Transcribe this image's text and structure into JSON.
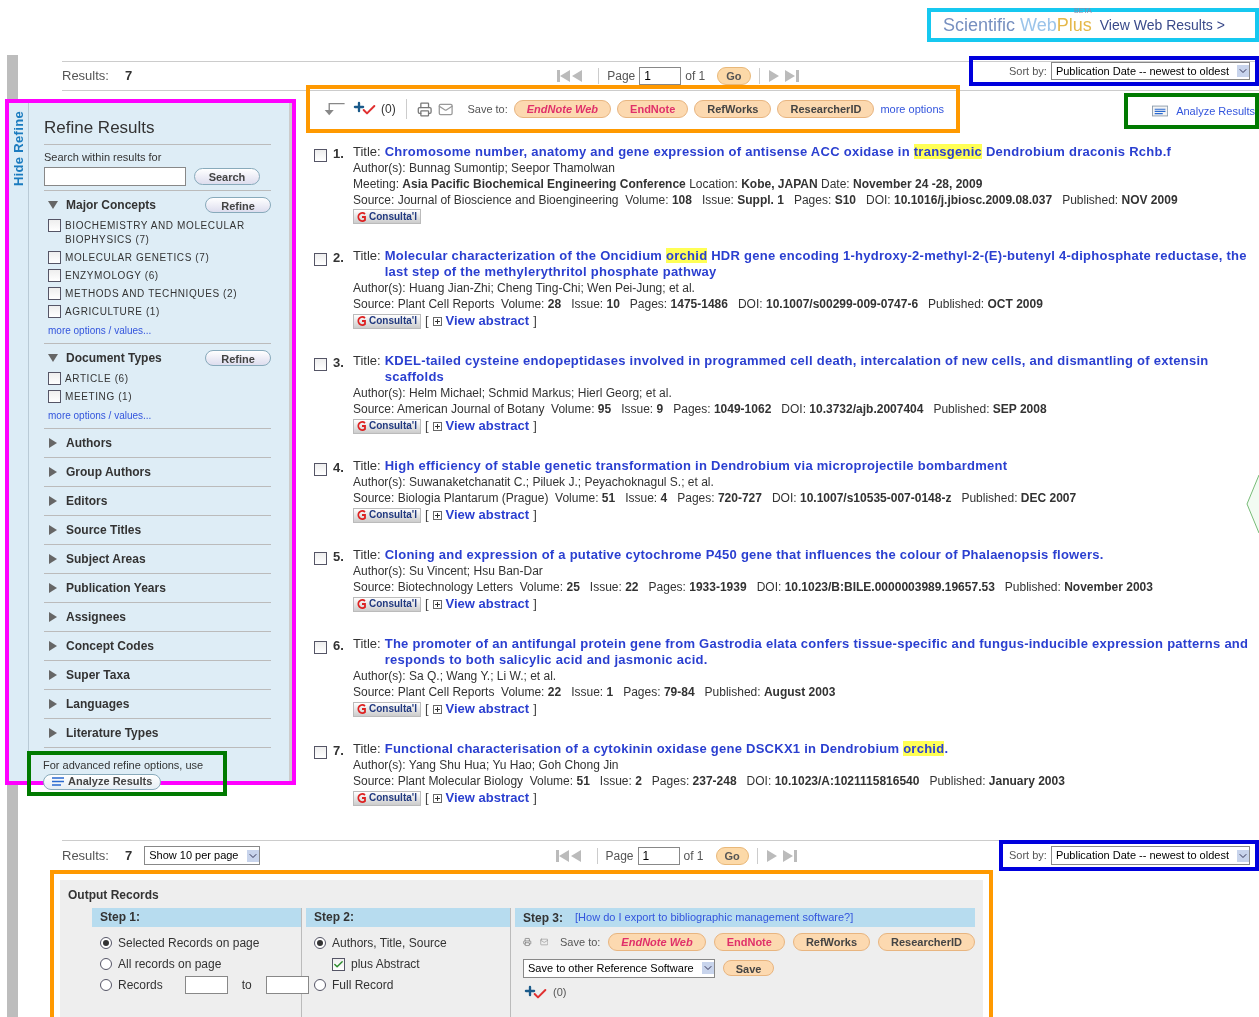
{
  "header": {
    "logo": {
      "word1": "Scientific ",
      "word2": "Web",
      "word3": "Plus",
      "badge": "BETA"
    },
    "view_web_link": "View Web Results >"
  },
  "top_bar": {
    "results_label": "Results:",
    "results_count": "7",
    "pager": {
      "page_label": "Page",
      "page_value": "1",
      "of_label": "of 1",
      "go": "Go"
    },
    "sort": {
      "label": "Sort by:",
      "value": "Publication Date -- newest to oldest"
    }
  },
  "toolbar": {
    "marked_count": "(0)",
    "save_to_label": "Save to:",
    "save_buttons": [
      {
        "label": "EndNote Web",
        "kind": "endnoteweb"
      },
      {
        "label": "EndNote",
        "kind": "endnote"
      },
      {
        "label": "RefWorks",
        "kind": "plain"
      },
      {
        "label": "ResearcherID",
        "kind": "plain"
      }
    ],
    "more_options": "more options",
    "analyze": "Analyze Results"
  },
  "sidebar": {
    "tab": "Hide Refine",
    "title": "Refine Results",
    "search_label": "Search within results for",
    "search_button": "Search",
    "sections": [
      {
        "label": "Major Concepts",
        "expanded": true,
        "refine_button": "Refine",
        "options": [
          {
            "label": "BIOCHEMISTRY AND MOLECULAR BIOPHYSICS (7)",
            "checked": false
          },
          {
            "label": "MOLECULAR GENETICS (7)",
            "checked": false
          },
          {
            "label": "ENZYMOLOGY (6)",
            "checked": false
          },
          {
            "label": "METHODS AND TECHNIQUES (2)",
            "checked": false
          },
          {
            "label": "AGRICULTURE (1)",
            "checked": false
          }
        ],
        "more": "more options / values..."
      },
      {
        "label": "Document Types",
        "expanded": true,
        "refine_button": "Refine",
        "options": [
          {
            "label": "ARTICLE (6)",
            "checked": false
          },
          {
            "label": "MEETING (1)",
            "checked": false
          }
        ],
        "more": "more options / values..."
      },
      {
        "label": "Authors",
        "expanded": false
      },
      {
        "label": "Group Authors",
        "expanded": false
      },
      {
        "label": "Editors",
        "expanded": false
      },
      {
        "label": "Source Titles",
        "expanded": false
      },
      {
        "label": "Subject Areas",
        "expanded": false
      },
      {
        "label": "Publication Years",
        "expanded": false
      },
      {
        "label": "Assignees",
        "expanded": false
      },
      {
        "label": "Concept Codes",
        "expanded": false
      },
      {
        "label": "Super Taxa",
        "expanded": false
      },
      {
        "label": "Languages",
        "expanded": false
      },
      {
        "label": "Literature Types",
        "expanded": false
      }
    ],
    "footer_text": "For advanced refine options, use",
    "footer_button": "Analyze Results"
  },
  "records": [
    {
      "number": "1.",
      "checked": false,
      "title_label": "Title:",
      "title": [
        {
          "text": "Chromosome number, anatomy and gene expression of antisense ACC oxidase in ",
          "highlight": false
        },
        {
          "text": "transgenic",
          "highlight": true
        },
        {
          "text": " Dendrobium draconis Rchb.f",
          "highlight": false
        }
      ],
      "lines": [
        "Author(s): Bunnag Sumontip; Seepor Thamolwan",
        "Meeting: **Asia Pacific Biochemical Engineering Conference** Location: **Kobe, JAPAN** Date: **November 24 -28, 2009**",
        "Source: Journal of Bioscience and Bioengineering  Volume: **108**   Issue: **Suppl. 1**   Pages: **S10**   DOI: **10.1016/j.jbiosc.2009.08.037**   Published: **NOV 2009**"
      ],
      "consult": "Consulta'l"
    },
    {
      "number": "2.",
      "checked": false,
      "title_label": "Title:",
      "title": [
        {
          "text": "Molecular characterization of the Oncidium ",
          "highlight": false
        },
        {
          "text": "orchid",
          "highlight": true
        },
        {
          "text": " HDR gene encoding 1-hydroxy-2-methyl-2-(E)-butenyl 4-diphosphate reductase, the last step of the methylerythritol phosphate pathway",
          "highlight": false
        }
      ],
      "lines": [
        "Author(s): Huang Jian-Zhi; Cheng Ting-Chi; Wen Pei-Jung; et al.",
        "Source: Plant Cell Reports  Volume: **28**   Issue: **10**   Pages: **1475-1486**   DOI: **10.1007/s00299-009-0747-6**   Published: **OCT 2009**"
      ],
      "consult": "Consulta'l",
      "abstract_open": "[",
      "abstract_link": "View abstract",
      "abstract_close": "]"
    },
    {
      "number": "3.",
      "checked": false,
      "title_label": "Title:",
      "title": [
        {
          "text": "KDEL-tailed cysteine endopeptidases involved in programmed cell death, intercalation of new cells, and dismantling of extensin scaffolds",
          "highlight": false
        }
      ],
      "lines": [
        "Author(s): Helm Michael; Schmid Markus; Hierl Georg; et al.",
        "Source: American Journal of Botany  Volume: **95**   Issue: **9**   Pages: **1049-1062**   DOI: **10.3732/ajb.2007404**   Published: **SEP 2008**"
      ],
      "consult": "Consulta'l",
      "abstract_open": "[",
      "abstract_link": "View abstract",
      "abstract_close": "]"
    },
    {
      "number": "4.",
      "checked": false,
      "title_label": "Title:",
      "title": [
        {
          "text": "High efficiency of stable genetic transformation in Dendrobium via microprojectile bombardment",
          "highlight": false
        }
      ],
      "lines": [
        "Author(s): Suwanaketchanatit C.; Piluek J.; Peyachoknagul S.; et al.",
        "Source: Biologia Plantarum (Prague)  Volume: **51**   Issue: **4**   Pages: **720-727**   DOI: **10.1007/s10535-007-0148-z**   Published: **DEC 2007**"
      ],
      "consult": "Consulta'l",
      "abstract_open": "[",
      "abstract_link": "View abstract",
      "abstract_close": "]"
    },
    {
      "number": "5.",
      "checked": false,
      "title_label": "Title:",
      "title": [
        {
          "text": "Cloning and expression of a putative cytochrome P450 gene that influences the colour of Phalaenopsis flowers.",
          "highlight": false
        }
      ],
      "lines": [
        "Author(s): Su Vincent; Hsu Ban-Dar",
        "Source: Biotechnology Letters  Volume: **25**   Issue: **22**   Pages: **1933-1939**   DOI: **10.1023/B:BILE.0000003989.19657.53**   Published: **November 2003**"
      ],
      "consult": "Consulta'l",
      "abstract_open": "[",
      "abstract_link": "View abstract",
      "abstract_close": "]"
    },
    {
      "number": "6.",
      "checked": false,
      "title_label": "Title:",
      "title": [
        {
          "text": "The promoter of an antifungal protein gene from Gastrodia elata confers tissue-specific and fungus-inducible expression patterns and responds to both salicylic acid and jasmonic acid.",
          "highlight": false
        }
      ],
      "lines": [
        "Author(s): Sa Q.; Wang Y.; Li W.; et al.",
        "Source: Plant Cell Reports  Volume: **22**   Issue: **1**   Pages: **79-84**   Published: **August 2003**"
      ],
      "consult": "Consulta'l",
      "abstract_open": "[",
      "abstract_link": "View abstract",
      "abstract_close": "]"
    },
    {
      "number": "7.",
      "checked": false,
      "title_label": "Title:",
      "title": [
        {
          "text": "Functional characterisation of a cytokinin oxidase gene DSCKX1 in Dendrobium ",
          "highlight": false
        },
        {
          "text": "orchid",
          "highlight": true
        },
        {
          "text": ".",
          "highlight": false
        }
      ],
      "lines": [
        "Author(s): Yang Shu Hua; Yu Hao; Goh Chong Jin",
        "Source: Plant Molecular Biology  Volume: **51**   Issue: **2**   Pages: **237-248**   DOI: **10.1023/A:1021115816540**   Published: **January 2003**"
      ],
      "consult": "Consulta'l",
      "abstract_open": "[",
      "abstract_link": "View abstract",
      "abstract_close": "]"
    }
  ],
  "bottom_bar": {
    "results_label": "Results:",
    "results_count": "7",
    "per_page": "Show 10 per page",
    "pager": {
      "page_label": "Page",
      "page_value": "1",
      "of_label": "of 1",
      "go": "Go"
    },
    "sort": {
      "label": "Sort by:",
      "value": "Publication Date -- newest to oldest"
    }
  },
  "output_records": {
    "title": "Output Records",
    "step1": {
      "label": "Step 1:",
      "options": [
        {
          "label": "Selected Records on page",
          "selected": true,
          "kind": "plain"
        },
        {
          "label": "All records on page",
          "selected": false,
          "kind": "plain"
        },
        {
          "label": "Records",
          "selected": false,
          "kind": "range",
          "to_label": "to"
        }
      ]
    },
    "step2": {
      "label": "Step 2:",
      "options": [
        {
          "label": "Authors, Title, Source",
          "selected": true,
          "kind": "radio"
        },
        {
          "label": "plus Abstract",
          "checked": true,
          "kind": "checkbox"
        },
        {
          "label": "Full Record",
          "selected": false,
          "kind": "radio"
        }
      ]
    },
    "step3": {
      "label": "Step 3:",
      "help_link": "[How do I export to bibliographic management software?]",
      "save_to_label": "Save to:",
      "save_buttons": [
        {
          "label": "EndNote Web",
          "kind": "endnoteweb"
        },
        {
          "label": "EndNote",
          "kind": "endnote"
        },
        {
          "label": "RefWorks",
          "kind": "plain"
        },
        {
          "label": "ResearcherID",
          "kind": "plain"
        }
      ],
      "other_select": "Save to other Reference Software",
      "save_button": "Save",
      "marked_count": "(0)"
    }
  }
}
